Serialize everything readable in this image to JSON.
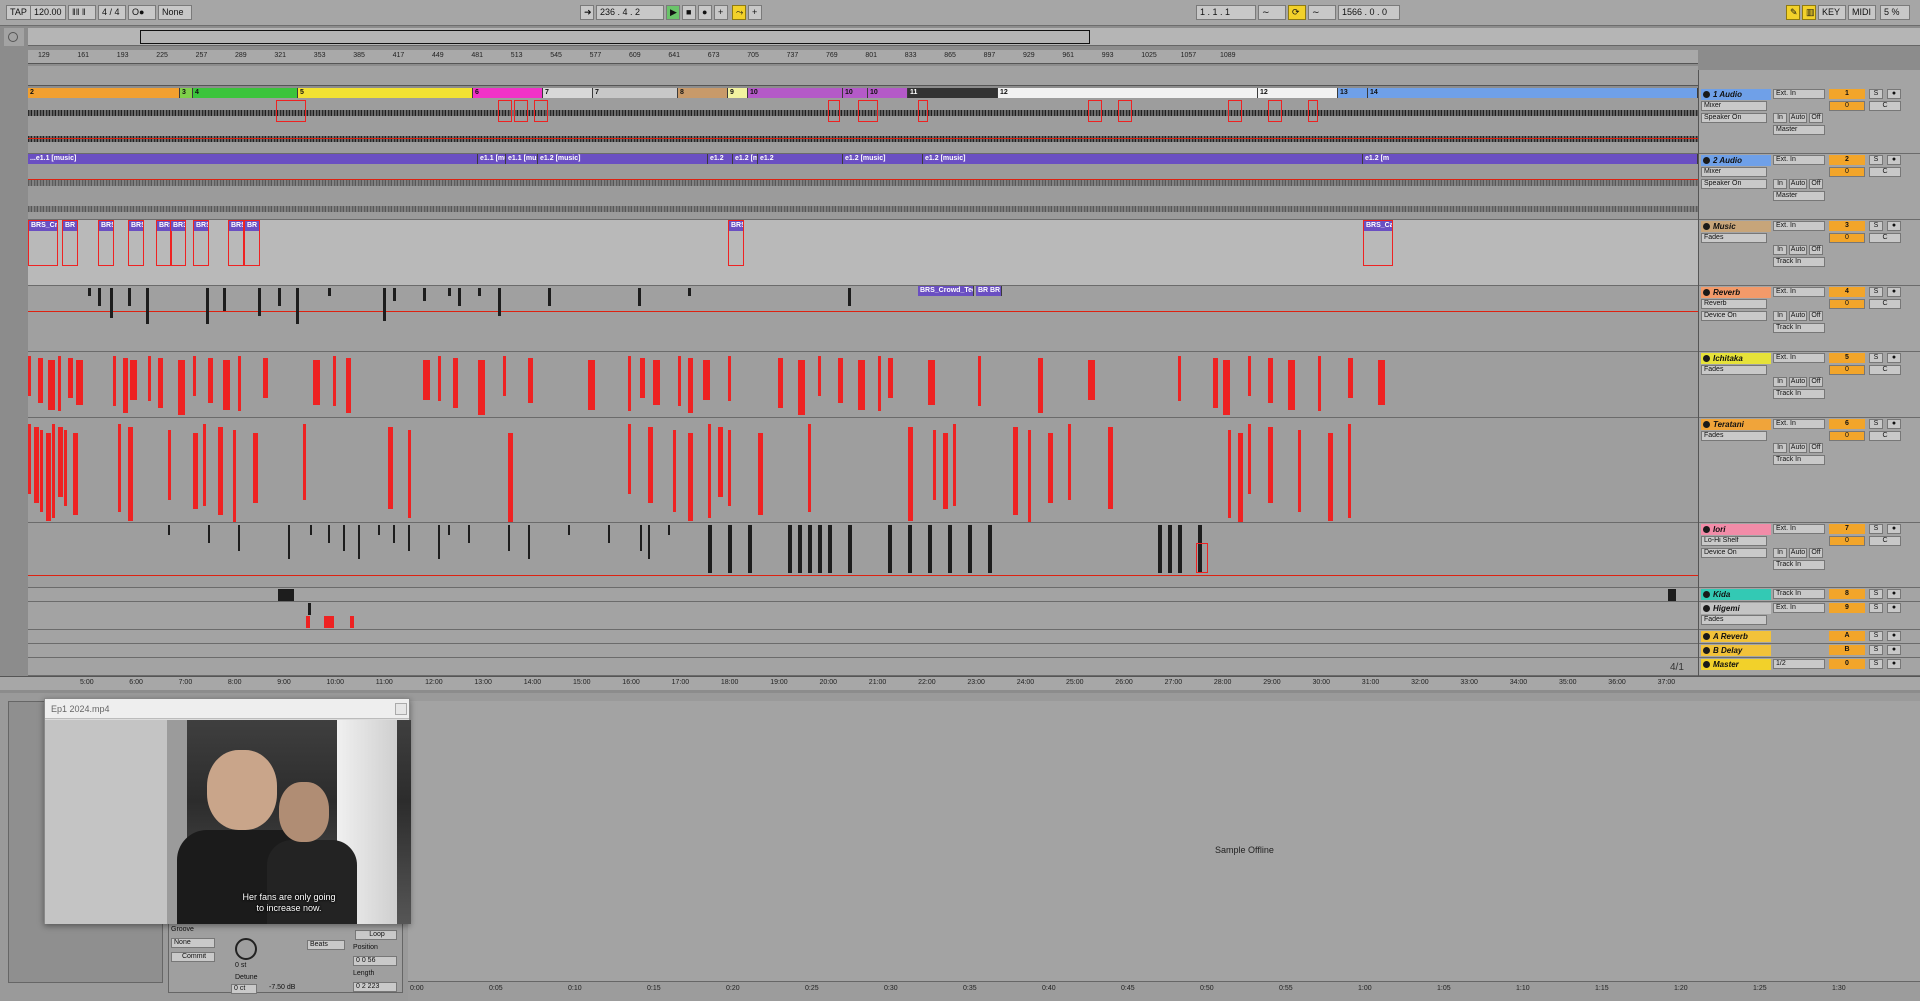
{
  "transport": {
    "tap": "TAP",
    "tempo": "120.00",
    "time_signature": "4 / 4",
    "metronome": "O●",
    "quantize": "None",
    "position": "236 . 4 . 2",
    "loop_start": "1 . 1 . 1",
    "loop_length": "1566 . 0 . 0",
    "key": "KEY",
    "midi": "MIDI",
    "cpu": "5 %"
  },
  "ruler_ticks": [
    "129",
    "161",
    "193",
    "225",
    "257",
    "289",
    "321",
    "353",
    "385",
    "417",
    "449",
    "481",
    "513",
    "545",
    "577",
    "609",
    "641",
    "673",
    "705",
    "737",
    "769",
    "801",
    "833",
    "865",
    "897",
    "929",
    "961",
    "993",
    "1025",
    "1057",
    "1089"
  ],
  "tracks": [
    {
      "name": "1 Audio",
      "number": "1",
      "color": "#6fa0e8",
      "input": "Ext. In",
      "device": "Mixer",
      "param": "Speaker On",
      "output": "Master"
    },
    {
      "name": "2 Audio",
      "number": "2",
      "color": "#6fa0e8",
      "input": "Ext. In",
      "device": "Mixer",
      "param": "Speaker On",
      "output": "Master"
    },
    {
      "name": "Music",
      "number": "3",
      "color": "#c7a57a",
      "input": "Ext. In",
      "device": "Fades",
      "param": "",
      "output": "Track In"
    },
    {
      "name": "Reverb",
      "number": "4",
      "color": "#f29a6a",
      "input": "Ext. In",
      "device": "Reverb",
      "param": "Device On",
      "output": "Track In"
    },
    {
      "name": "Ichitaka",
      "number": "5",
      "color": "#e6e23a",
      "input": "Ext. In",
      "device": "Fades",
      "param": "",
      "output": "Track In"
    },
    {
      "name": "Teratani",
      "number": "6",
      "color": "#f0a43a",
      "input": "Ext. In",
      "device": "Fades",
      "param": "",
      "output": "Track In"
    },
    {
      "name": "Iori",
      "number": "7",
      "color": "#f28ca8",
      "input": "Ext. In",
      "device": "Lo-Hi Shelf",
      "param": "Device On",
      "output": "Track In"
    },
    {
      "name": "Kida",
      "number": "8",
      "color": "#33c9b4",
      "input": "Track In",
      "device": "",
      "param": "",
      "output": ""
    },
    {
      "name": "Higemi",
      "number": "9",
      "color": "#c4c4c4",
      "input": "Ext. In",
      "device": "Fades",
      "param": "",
      "output": ""
    },
    {
      "name": "A Reverb",
      "number": "A",
      "color": "#f2c23a",
      "input": "",
      "device": "",
      "param": "",
      "output": ""
    },
    {
      "name": "B Delay",
      "number": "B",
      "color": "#f2c23a",
      "input": "",
      "device": "",
      "param": "",
      "output": ""
    },
    {
      "name": "Master",
      "number": "0",
      "color": "#f2d12a",
      "input": "1/2",
      "device": "",
      "param": "",
      "output": ""
    }
  ],
  "clip_labels": {
    "audio1_markers": [
      "2",
      "3",
      "4",
      "5",
      "6",
      "7",
      "7",
      "8",
      "9",
      "10",
      "10",
      "10",
      "11",
      "12",
      "12",
      "13",
      "14"
    ],
    "audio2_clips": [
      "...e1.1 [music]",
      "e1.1 [mu",
      "e1.1 [music]",
      "e1.2 [music]",
      "e1.2",
      "e1.2 [music]",
      "e1.2",
      "e1.2 [music]",
      "e1.2 [music]",
      "e1.2 [m"
    ],
    "music_clips": [
      "BRS_Cro",
      "BR",
      "BRS",
      "BRS",
      "BRS",
      "BR3",
      "BRS",
      "BRS",
      "BR",
      "BRS",
      "BRS_Ca"
    ],
    "reverb_clips": [
      "BRS_Crowd_Teens",
      "BR",
      "BR"
    ]
  },
  "status_times": [
    "5:00",
    "6:00",
    "7:00",
    "8:00",
    "9:00",
    "10:00",
    "11:00",
    "12:00",
    "13:00",
    "14:00",
    "15:00",
    "16:00",
    "17:00",
    "18:00",
    "19:00",
    "20:00",
    "21:00",
    "22:00",
    "23:00",
    "24:00",
    "25:00",
    "26:00",
    "27:00",
    "28:00",
    "29:00",
    "30:00",
    "31:00",
    "32:00",
    "33:00",
    "34:00",
    "35:00",
    "36:00",
    "37:00"
  ],
  "zoom_indicator": "4/1",
  "video": {
    "title": "Ep1 2024.mp4",
    "subtitle_line1": "Her fans are only going",
    "subtitle_line2": "to increase now."
  },
  "clip_view": {
    "groove_label": "Groove",
    "groove_value": "None",
    "commit": "Commit",
    "transpose_value": "0 st",
    "detune_label": "Detune",
    "detune_value": "0 ct",
    "gain_value": "-7.50 dB",
    "warp_mode": "Beats",
    "loop": "Loop",
    "position_label": "Position",
    "position_value": "0  0  56",
    "length_label": "Length",
    "length_value": "0  2  223",
    "sample_offline": "Sample Offline"
  },
  "wave_ruler": [
    "0:00",
    "0:05",
    "0:10",
    "0:15",
    "0:20",
    "0:25",
    "0:30",
    "0:35",
    "0:40",
    "0:45",
    "0:50",
    "0:55",
    "1:00",
    "1:05",
    "1:10",
    "1:15",
    "1:20",
    "1:25",
    "1:30"
  ]
}
